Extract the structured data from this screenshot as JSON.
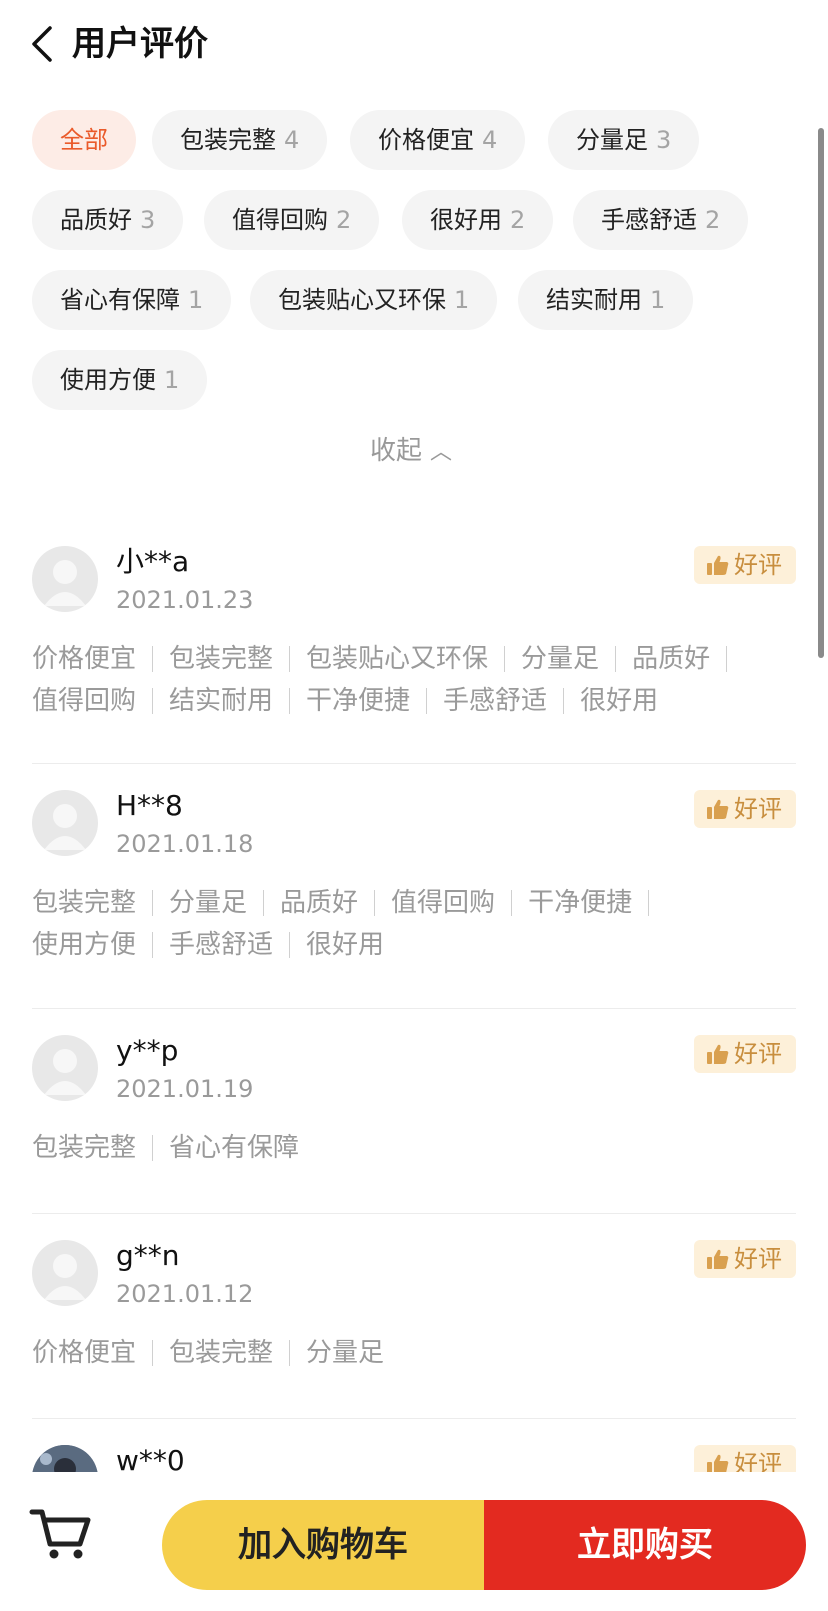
{
  "header": {
    "title": "用户评价"
  },
  "filter_tags": [
    {
      "label": "全部",
      "count": "",
      "active": true
    },
    {
      "label": "包装完整",
      "count": "4"
    },
    {
      "label": "价格便宜",
      "count": "4"
    },
    {
      "label": "分量足",
      "count": "3"
    },
    {
      "label": "品质好",
      "count": "3"
    },
    {
      "label": "值得回购",
      "count": "2"
    },
    {
      "label": "很好用",
      "count": "2"
    },
    {
      "label": "手感舒适",
      "count": "2"
    },
    {
      "label": "省心有保障",
      "count": "1"
    },
    {
      "label": "包装贴心又环保",
      "count": "1"
    },
    {
      "label": "结实耐用",
      "count": "1"
    },
    {
      "label": "使用方便",
      "count": "1"
    }
  ],
  "collapse_label": "收起",
  "reviews": [
    {
      "user": "小**a",
      "date": "2021.01.23",
      "badge": "好评",
      "tags": [
        "价格便宜",
        "包装完整",
        "包装贴心又环保",
        "分量足",
        "品质好",
        "值得回购",
        "结实耐用",
        "干净便捷",
        "手感舒适",
        "很好用"
      ]
    },
    {
      "user": "H**8",
      "date": "2021.01.18",
      "badge": "好评",
      "tags": [
        "包装完整",
        "分量足",
        "品质好",
        "值得回购",
        "干净便捷",
        "使用方便",
        "手感舒适",
        "很好用"
      ]
    },
    {
      "user": "y**p",
      "date": "2021.01.19",
      "badge": "好评",
      "tags": [
        "包装完整",
        "省心有保障"
      ]
    },
    {
      "user": "g**n",
      "date": "2021.01.12",
      "badge": "好评",
      "tags": [
        "价格便宜",
        "包装完整",
        "分量足"
      ]
    },
    {
      "user": "w**0",
      "date": "",
      "badge": "好评",
      "tags": []
    }
  ],
  "bottom_bar": {
    "add_to_cart": "加入购物车",
    "buy_now": "立即购买"
  },
  "colors": {
    "accent": "#ea5a2a",
    "badge_text": "#c88e3e",
    "buy_red": "#e32a20",
    "cart_yellow": "#f5cf4b"
  },
  "icons": {
    "back": "chevron-left-icon",
    "cart": "cart-icon",
    "thumb": "thumbs-up-icon",
    "avatar": "default-avatar-icon"
  }
}
